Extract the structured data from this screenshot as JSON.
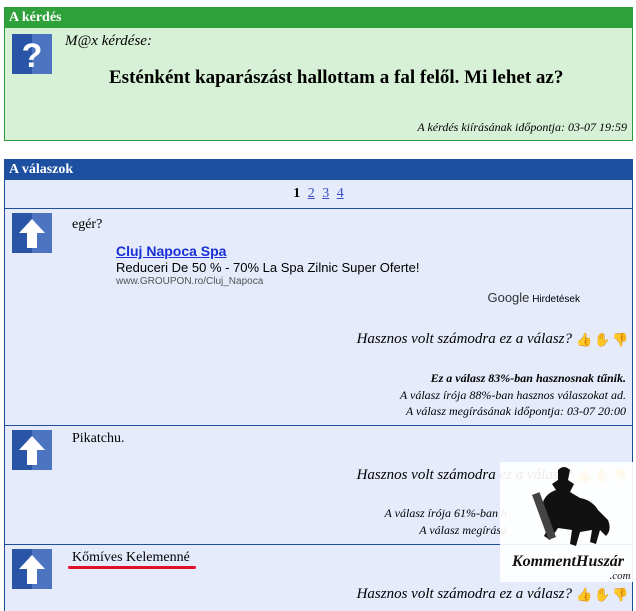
{
  "question": {
    "header": "A kérdés",
    "asker": "M@x kérdése:",
    "text": "Esténként kaparászást hallottam a fal felől. Mi lehet az?",
    "timestamp": "A kérdés kiírásának időpontja: 03-07 19:59"
  },
  "answers_section": {
    "header": "A válaszok",
    "pagination": {
      "current": "1",
      "pages": [
        "2",
        "3",
        "4"
      ]
    }
  },
  "answers": [
    {
      "text": "egér?",
      "ad": {
        "title": "Cluj Napoca Spa",
        "desc": "Reduceri De 50 % - 70% La Spa Zilnic Super Oferte!",
        "url": "www.GROUPON.ro/Cluj_Napoca",
        "google": "Google",
        "google_suffix": "Hirdetések"
      },
      "useful_q": "Hasznos volt számodra ez a válasz?",
      "rating": "Ez a válasz 83%-ban hasznosnak tűnik.",
      "author_rating": "A válasz írója 88%-ban hasznos válaszokat ad.",
      "time": "A válasz megírásának időpontja: 03-07 20:00"
    },
    {
      "text": "Pikatchu.",
      "useful_q": "Hasznos volt számodra ez a válasz?",
      "author_rating": "A válasz írója 61%-ban h",
      "time": "A válasz megírásá"
    },
    {
      "text": "Kőmíves Kelemenné",
      "useful_q": "Hasznos volt számodra ez a válasz?"
    }
  ],
  "watermark": {
    "text": "KommentHuszár",
    "suffix": ".com"
  },
  "colors": {
    "green_header": "#2ea13a",
    "green_bg": "#d7f1d6",
    "blue_header": "#1c4f9f",
    "blue_bg": "#e5ebfb",
    "icon": "#2a55a6"
  }
}
